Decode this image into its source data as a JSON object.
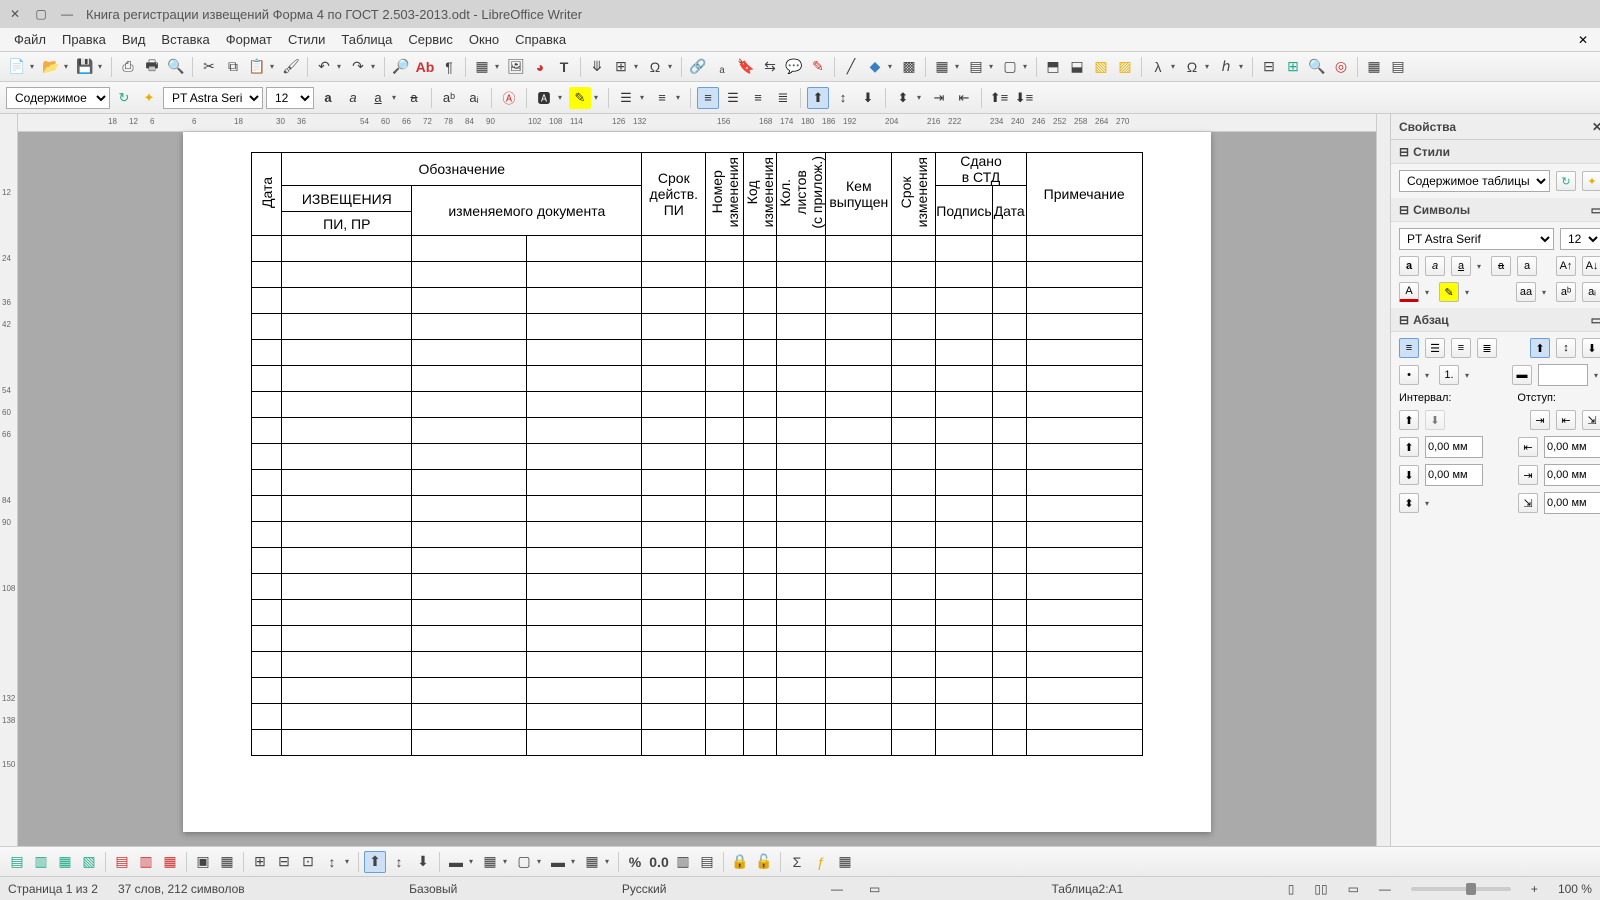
{
  "titlebar": {
    "title": "Книга регистрации извещений Форма 4 по ГОСТ 2.503-2013.odt - LibreOffice Writer"
  },
  "menu": {
    "items": [
      "Файл",
      "Правка",
      "Вид",
      "Вставка",
      "Формат",
      "Стили",
      "Таблица",
      "Сервис",
      "Окно",
      "Справка"
    ]
  },
  "formatbar": {
    "paragraph_style": "Содержимое таб.",
    "font_name": "PT Astra Serif",
    "font_size": "12"
  },
  "hruler_ticks": [
    "18",
    "12",
    "6",
    "",
    "6",
    "",
    "18",
    "",
    "30",
    "36",
    "",
    "",
    "54",
    "60",
    "66",
    "72",
    "78",
    "84",
    "90",
    "",
    "102",
    "108",
    "114",
    "",
    "126",
    "132",
    "",
    "",
    "",
    "156",
    "",
    "168",
    "174",
    "180",
    "186",
    "192",
    "",
    "204",
    "",
    "216",
    "222",
    "",
    "234",
    "240",
    "246",
    "252",
    "258",
    "264",
    "270"
  ],
  "vruler_ticks": [
    "",
    "",
    "12",
    "",
    "",
    "24",
    "",
    "36",
    "42",
    "",
    "",
    "54",
    "60",
    "66",
    "",
    "",
    "84",
    "90",
    "",
    "",
    "108",
    "",
    "",
    "",
    "",
    "132",
    "138",
    "",
    "150"
  ],
  "table": {
    "hdr_oboz": "Обозначение",
    "hdr_izv": "ИЗВЕЩЕНИЯ",
    "hdr_pipr": "ПИ, ПР",
    "hdr_izm_doc": "изменяемого документа",
    "hdr_data": "Дата",
    "hdr_srok_pi_1": "Срок",
    "hdr_srok_pi_2": "действ.",
    "hdr_srok_pi_3": "ПИ",
    "hdr_nomer": "Номер",
    "hdr_kod_izm": "Код",
    "hdr_izmenenia": "изменения",
    "hdr_kol": "Кол.",
    "hdr_listov": "листов",
    "hdr_prilozh": "(с прилож.)",
    "hdr_kem_1": "Кем",
    "hdr_kem_2": "выпущен",
    "hdr_srok": "Срок",
    "hdr_sdano_1": "Сдано",
    "hdr_sdano_2": "в СТД",
    "hdr_podpis": "Подпись",
    "hdr_sd_data": "Дата",
    "hdr_prim": "Примечание"
  },
  "sidebar": {
    "title": "Свойства",
    "sec_styli": "Стили",
    "sec_symbols": "Символы",
    "sec_abzac": "Абзац",
    "style_val": "Содержимое таблицы",
    "font_val": "PT Astra Serif",
    "size_val": "12",
    "interval_label": "Интервал:",
    "otstup_label": "Отступ:",
    "spin_zero": "0,00 мм"
  },
  "statusbar": {
    "page": "Страница 1 из 2",
    "words": "37 слов, 212 символов",
    "style": "Базовый",
    "lang": "Русский",
    "cell": "Таблица2:A1",
    "zoom": "100 %"
  }
}
